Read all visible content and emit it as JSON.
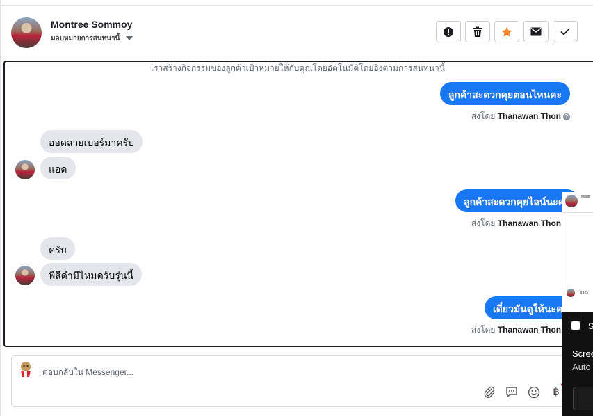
{
  "header": {
    "name": "Montree Sommoy",
    "assign_label": "มอบหมายการสนทนานี้",
    "actions": [
      {
        "icon": "alert-circle-icon",
        "color": "#1c1e21"
      },
      {
        "icon": "trash-icon",
        "color": "#1c1e21"
      },
      {
        "icon": "star-icon",
        "color": "#f5832a"
      },
      {
        "icon": "envelope-icon",
        "color": "#1c1e21"
      },
      {
        "icon": "check-icon",
        "color": "#1c1e21"
      }
    ]
  },
  "conversation": {
    "system_note": "เราสร้างกิจกรรมของลูกค้าเป้าหมายให้กับคุณโดยอัตโนมัติโดยอิงตามการสนทนานี้",
    "sent_by_prefix": "ส่งโดย",
    "agent_name": "Thanawan Thon",
    "messages": [
      {
        "direction": "out",
        "text": "ลูกค้าสะดวกคุยตอนไหนคะ"
      },
      {
        "direction": "in",
        "text": "ออดลายเบอร์มาครับ"
      },
      {
        "direction": "in",
        "text": "แอด"
      },
      {
        "direction": "out",
        "text": "ลูกค้าสะดวกคุยไลน์นะคะ"
      },
      {
        "direction": "in",
        "text": "ครับ"
      },
      {
        "direction": "in",
        "text": "พี่สีดำมีไหมครับรุ่นนี้"
      },
      {
        "direction": "out",
        "text": "เดี๋ยวมันดูให้นะคะ"
      }
    ]
  },
  "composer": {
    "placeholder": "ตอบกลับใน Messenger...",
    "tools": [
      "paperclip-icon",
      "saved-reply-icon",
      "emoji-icon",
      "baht-icon"
    ],
    "baht_symbol": "฿"
  },
  "overlay": {
    "name_snippet": "Montr",
    "sub_snippet": "มอบหมาย",
    "msg_snippet": "พี่สีดำ",
    "title_fragment": "S",
    "line1": "Scree",
    "line2": "Auto"
  },
  "colors": {
    "accent": "#1877f2",
    "incoming_bubble": "#e4e6eb",
    "star": "#f5832a"
  }
}
